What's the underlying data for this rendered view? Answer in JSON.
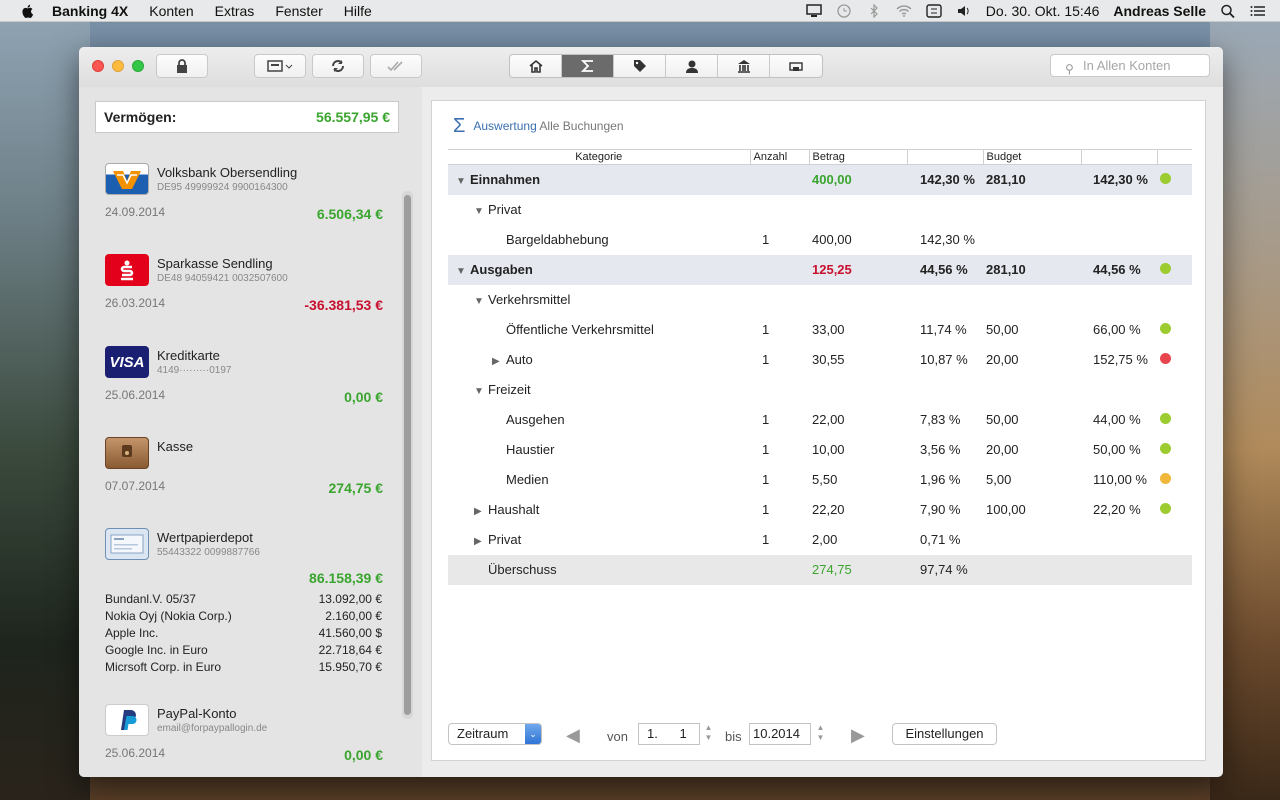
{
  "menubar": {
    "app": "Banking 4X",
    "items": [
      "Konten",
      "Extras",
      "Fenster",
      "Hilfe"
    ],
    "clock": "Do. 30. Okt.  15:46",
    "user": "Andreas Selle"
  },
  "toolbar": {
    "search_placeholder": "In Allen Konten"
  },
  "sidebar": {
    "total_label": "Vermögen:",
    "total_value": "56.557,95 €",
    "accounts": [
      {
        "name": "Volksbank Obersendling",
        "iban": "DE95 49999924 9900164300",
        "date": "24.09.2014",
        "balance": "6.506,34 €",
        "logo": "volksbank-logo"
      },
      {
        "name": "Sparkasse Sendling",
        "iban": "DE48 94059421 0032507600",
        "date": "26.03.2014",
        "balance": "-36.381,53 €",
        "logo": "sparkasse-logo"
      },
      {
        "name": "Kreditkarte",
        "iban": "4149·········0197",
        "date": "25.06.2014",
        "balance": "0,00 €",
        "logo": "visa-logo",
        "logo_text": "VISA"
      },
      {
        "name": "Kasse",
        "iban": "",
        "date": "07.07.2014",
        "balance": "274,75 €",
        "logo": "wallet-logo"
      },
      {
        "name": "Wertpapierdepot",
        "iban": "55443322 0099887766",
        "date": "",
        "balance": "86.158,39 €",
        "logo": "depot-logo"
      },
      {
        "name": "PayPal-Konto",
        "iban": "email@forpaypallogin.de",
        "date": "25.06.2014",
        "balance": "0,00 €",
        "logo": "paypal-logo"
      }
    ],
    "holdings": [
      {
        "name": "Bundanl.V. 05/37",
        "value": "13.092,00 €"
      },
      {
        "name": "Nokia Oyj (Nokia Corp.)",
        "value": "2.160,00 €"
      },
      {
        "name": "Apple Inc.",
        "value": "41.560,00 $"
      },
      {
        "name": "Google Inc. in Euro",
        "value": "22.718,64 €"
      },
      {
        "name": "Micrsoft Corp. in Euro",
        "value": "15.950,70 €"
      }
    ]
  },
  "main": {
    "title": "Auswertung",
    "subtitle": "Alle Buchungen",
    "columns": [
      "Kategorie",
      "Anzahl",
      "Betrag",
      "",
      "Budget",
      "",
      ""
    ],
    "colors": {
      "green": "#9ccc2f",
      "red": "#e8454f",
      "orange": "#f0b73a",
      "amount_green": "#3aa52e",
      "amount_red": "#c8102e"
    },
    "rows": [
      {
        "cat": "Einnahmen",
        "anz": "",
        "betrag": "400,00",
        "pct": "142,30 %",
        "budget": "281,10",
        "bpct": "142,30 %",
        "dot": "green"
      },
      {
        "cat": "Privat",
        "anz": "",
        "betrag": "",
        "pct": "",
        "budget": "",
        "bpct": "",
        "dot": ""
      },
      {
        "cat": "Bargeldabhebung",
        "anz": "1",
        "betrag": "400,00",
        "pct": "142,30 %",
        "budget": "",
        "bpct": "",
        "dot": ""
      },
      {
        "cat": "Ausgaben",
        "anz": "",
        "betrag": "125,25",
        "pct": "44,56 %",
        "budget": "281,10",
        "bpct": "44,56 %",
        "dot": "green"
      },
      {
        "cat": "Verkehrsmittel",
        "anz": "",
        "betrag": "",
        "pct": "",
        "budget": "",
        "bpct": "",
        "dot": ""
      },
      {
        "cat": "Öffentliche Verkehrsmittel",
        "anz": "1",
        "betrag": "33,00",
        "pct": "11,74 %",
        "budget": "50,00",
        "bpct": "66,00 %",
        "dot": "green"
      },
      {
        "cat": "Auto",
        "anz": "1",
        "betrag": "30,55",
        "pct": "10,87 %",
        "budget": "20,00",
        "bpct": "152,75 %",
        "dot": "red"
      },
      {
        "cat": "Freizeit",
        "anz": "",
        "betrag": "",
        "pct": "",
        "budget": "",
        "bpct": "",
        "dot": ""
      },
      {
        "cat": "Ausgehen",
        "anz": "1",
        "betrag": "22,00",
        "pct": "7,83 %",
        "budget": "50,00",
        "bpct": "44,00 %",
        "dot": "green"
      },
      {
        "cat": "Haustier",
        "anz": "1",
        "betrag": "10,00",
        "pct": "3,56 %",
        "budget": "20,00",
        "bpct": "50,00 %",
        "dot": "green"
      },
      {
        "cat": "Medien",
        "anz": "1",
        "betrag": "5,50",
        "pct": "1,96 %",
        "budget": "5,00",
        "bpct": "110,00 %",
        "dot": "orange"
      },
      {
        "cat": "Haushalt",
        "anz": "1",
        "betrag": "22,20",
        "pct": "7,90 %",
        "budget": "100,00",
        "bpct": "22,20 %",
        "dot": "green"
      },
      {
        "cat": "Privat",
        "anz": "1",
        "betrag": "2,00",
        "pct": "0,71 %",
        "budget": "",
        "bpct": "",
        "dot": ""
      },
      {
        "cat": "Überschuss",
        "anz": "",
        "betrag": "274,75",
        "pct": "97,74 %",
        "budget": "",
        "bpct": "",
        "dot": ""
      }
    ],
    "footer": {
      "period_select": "Zeitraum",
      "from_label": "von",
      "from_value": "1.      1",
      "to_label": "bis",
      "to_value": "10.2014",
      "settings_button": "Einstellungen"
    }
  }
}
